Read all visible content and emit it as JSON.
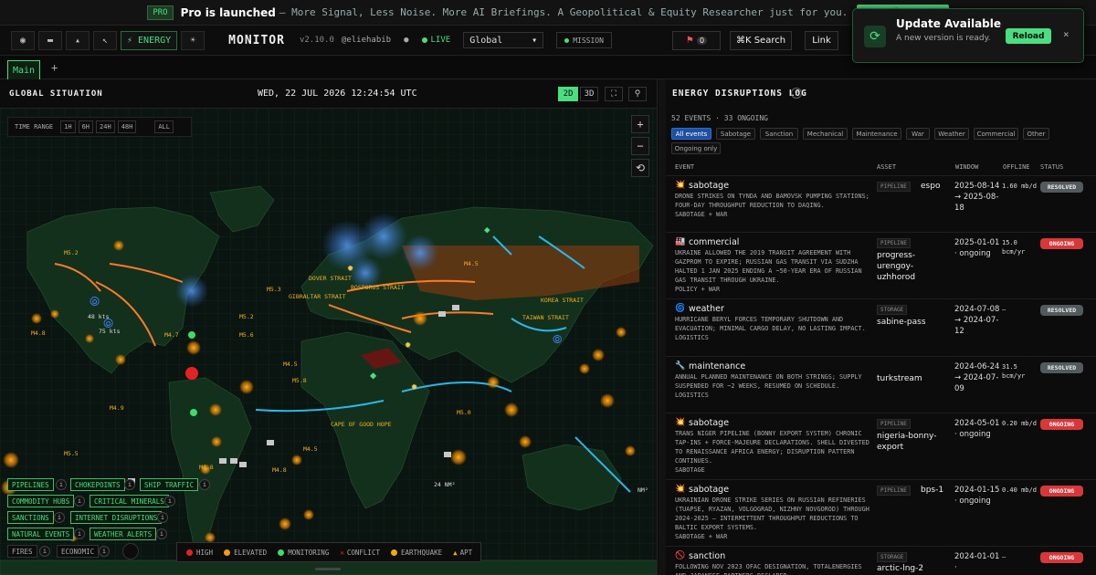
{
  "banner": {
    "pro": "PRO",
    "title": "Pro is launched",
    "sub": "– More Signal, Less Noise. More AI Briefings. A Geopolitical & Equity Researcher just for you.",
    "upgrade": "Upgrade to Pro"
  },
  "topbar": {
    "energy": "⚡ ENERGY",
    "brand": "MONITOR",
    "version": "v2.10.0",
    "handle": "@eliehabib",
    "live": "LIVE",
    "region": "Global",
    "mission": "MISSION",
    "alerts": "0",
    "search": "⌘K  Search",
    "link": "Link"
  },
  "toast": {
    "title": "Update Available",
    "body": "A new version is ready.",
    "reload": "Reload",
    "close": "×"
  },
  "tabs": {
    "main": "Main",
    "add": "+"
  },
  "map": {
    "title": "GLOBAL SITUATION",
    "date": "WED, 22 JUL 2026 12:24:54 UTC",
    "view2d": "2D",
    "view3d": "3D",
    "time_range": {
      "label": "TIME RANGE",
      "options": [
        "1H",
        "6H",
        "24H",
        "48H"
      ],
      "all": "ALL"
    },
    "zoom": {
      "in": "+",
      "out": "−",
      "reset": "⟲"
    },
    "labels": {
      "dover": "DOVER STRAIT",
      "gibraltar": "GIBRALTAR STRAIT",
      "bosporus": "BOSPORUS STRAIT",
      "korea": "KOREA STRAIT",
      "taiwan": "TAIWAN STRAIT",
      "cape": "CAPE OF GOOD HOPE",
      "m1": "M4.8",
      "m2": "M5.2",
      "m3": "M5.3",
      "m4": "M5.2",
      "m5": "M5.6",
      "m6": "M4.5",
      "m7": "M4.5",
      "m8": "M4.9",
      "m9": "M5.5",
      "m10": "M5.0",
      "m11": "M4.5",
      "m12": "M4.8",
      "m13": "M4.8",
      "m14": "M4.7",
      "m15": "M5.8",
      "k1": "48 kts",
      "k2": "75 kts",
      "s1": "24 NM²",
      "s2": "NM²"
    },
    "layers": [
      {
        "label": "PIPELINES"
      },
      {
        "label": "CHOKEPOINTS"
      },
      {
        "label": "SHIP TRAFFIC"
      },
      {
        "label": "COMMODITY HUBS"
      },
      {
        "label": "CRITICAL MINERALS"
      },
      {
        "label": "SANCTIONS"
      },
      {
        "label": "INTERNET DISRUPTIONS"
      },
      {
        "label": "NATURAL EVENTS"
      },
      {
        "label": "WEATHER ALERTS"
      },
      {
        "label": "FIRES"
      },
      {
        "label": "ECONOMIC"
      }
    ],
    "legend": {
      "high": "HIGH",
      "elevated": "ELEVATED",
      "monitoring": "MONITORING",
      "conflict": "CONFLICT",
      "earthquake": "EARTHQUAKE",
      "apt": "APT"
    }
  },
  "panel": {
    "title": "ENERGY DISRUPTIONS LOG",
    "help": "?",
    "stats": "52 EVENTS · 33 ONGOING",
    "filters": [
      "All events",
      "Sabotage",
      "Sanction",
      "Mechanical",
      "Maintenance",
      "War",
      "Weather",
      "Commercial",
      "Other"
    ],
    "ongoing_only": "Ongoing only",
    "headers": {
      "event": "EVENT",
      "asset": "ASSET",
      "window": "WINDOW",
      "offline": "OFFLINE",
      "status": "STATUS"
    },
    "rows": [
      {
        "icon": "💥",
        "type": "sabotage",
        "desc": "DRONE STRIKES ON TYNDA AND BAMOVSK PUMPING STATIONS; FOUR-DAY THROUGHPUT REDUCTION TO DAQING.",
        "tags": "SABOTAGE + WAR",
        "asset_type": "PIPELINE",
        "asset": "espo",
        "window": "2025-08-14 → 2025-08-18",
        "offline": "1.60 mb/d",
        "status": "RESOLVED"
      },
      {
        "icon": "🏭",
        "type": "commercial",
        "desc": "UKRAINE ALLOWED THE 2019 TRANSIT AGREEMENT WITH GAZPROM TO EXPIRE; RUSSIAN GAS TRANSIT VIA SUDZHA HALTED 1 JAN 2025 ENDING A ~50-YEAR ERA OF RUSSIAN GAS TRANSIT THROUGH UKRAINE.",
        "tags": "POLICY + WAR",
        "asset_type": "PIPELINE",
        "asset": "progress-urengoy-uzhhorod",
        "window": "2025-01-01 · ongoing",
        "offline": "15.0 bcm/yr",
        "status": "ONGOING"
      },
      {
        "icon": "🌀",
        "type": "weather",
        "desc": "HURRICANE BERYL FORCES TEMPORARY SHUTDOWN AND EVACUATION; MINIMAL CARGO DELAY, NO LASTING IMPACT.",
        "tags": "LOGISTICS",
        "asset_type": "STORAGE",
        "asset": "sabine-pass",
        "window": "2024-07-08 → 2024-07-12",
        "offline": "—",
        "status": "RESOLVED"
      },
      {
        "icon": "🔧",
        "type": "maintenance",
        "desc": "ANNUAL PLANNED MAINTENANCE ON BOTH STRINGS; SUPPLY SUSPENDED FOR ~2 WEEKS, RESUMED ON SCHEDULE.",
        "tags": "LOGISTICS",
        "asset_type": "",
        "asset": "turkstream",
        "window": "2024-06-24 → 2024-07-09",
        "offline": "31.5 bcm/yr",
        "status": "RESOLVED"
      },
      {
        "icon": "💥",
        "type": "sabotage",
        "desc": "TRANS NIGER PIPELINE (BONNY EXPORT SYSTEM) CHRONIC TAP-INS + FORCE-MAJEURE DECLARATIONS. SHELL DIVESTED TO RENAISSANCE AFRICA ENERGY; DISRUPTION PATTERN CONTINUES.",
        "tags": "SABOTAGE",
        "asset_type": "PIPELINE",
        "asset": "nigeria-bonny-export",
        "window": "2024-05-01 · ongoing",
        "offline": "0.20 mb/d",
        "status": "ONGOING"
      },
      {
        "icon": "💥",
        "type": "sabotage",
        "desc": "UKRAINIAN DRONE STRIKE SERIES ON RUSSIAN REFINERIES (TUAPSE, RYAZAN, VOLGOGRAD, NIZHNY NOVGOROD) THROUGH 2024-2025 — INTERMITTENT THROUGHPUT REDUCTIONS TO BALTIC EXPORT SYSTEMS.",
        "tags": "SABOTAGE + WAR",
        "asset_type": "PIPELINE",
        "asset": "bps-1",
        "window": "2024-01-15 · ongoing",
        "offline": "0.40 mb/d",
        "status": "ONGOING"
      },
      {
        "icon": "🚫",
        "type": "sanction",
        "desc": "FOLLOWING NOV 2023 OFAC DESIGNATION, TOTALENERGIES AND JAPANESE PARTNERS DECLARED",
        "tags": "",
        "asset_type": "STORAGE",
        "asset": "arctic-lng-2",
        "window": "2024-01-01 ·",
        "offline": "—",
        "status": "ONGOING"
      }
    ]
  }
}
